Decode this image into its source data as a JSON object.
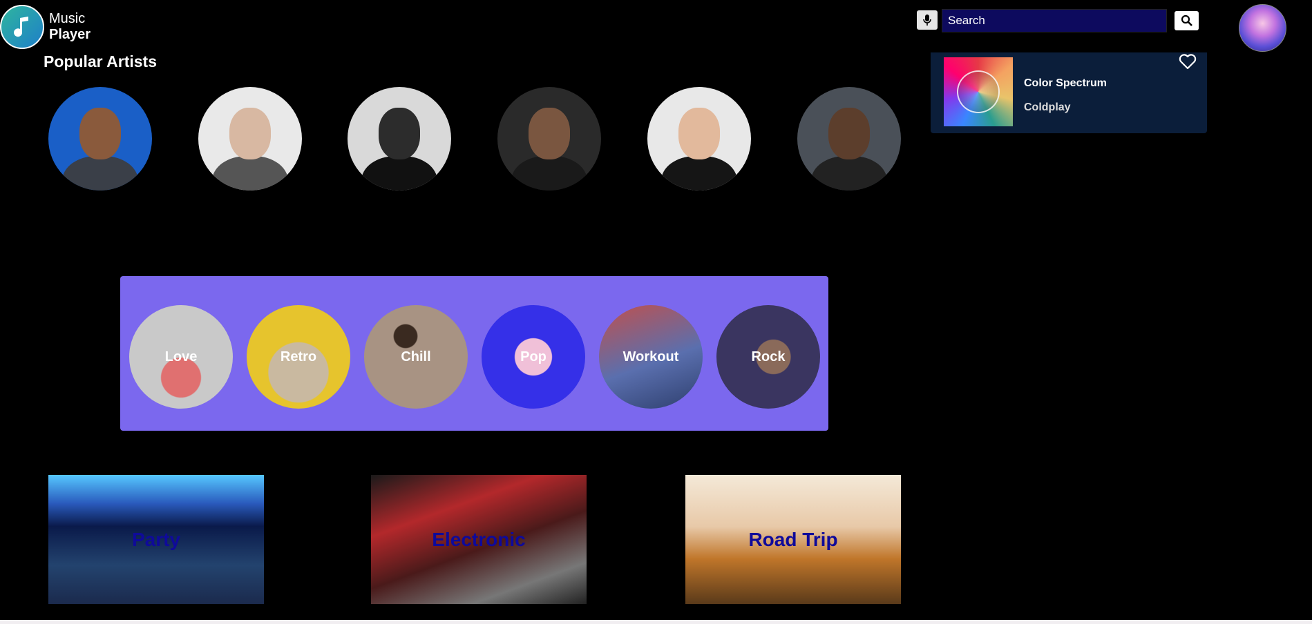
{
  "logo": {
    "line1": "Music",
    "line2": "Player",
    "icon": "music-note-icon"
  },
  "search": {
    "placeholder": "Search",
    "value": "",
    "mic_icon": "microphone-icon",
    "button_icon": "search-icon"
  },
  "profile": {
    "icon": "user-avatar"
  },
  "now_playing": {
    "title": "Color Spectrum",
    "artist": "Coldplay",
    "favorite_icon": "heart-outline-icon"
  },
  "popular_artists": {
    "title": "Popular Artists",
    "count": 6
  },
  "genres": [
    {
      "label": "Love"
    },
    {
      "label": "Retro"
    },
    {
      "label": "Chill"
    },
    {
      "label": "Pop"
    },
    {
      "label": "Workout"
    },
    {
      "label": "Rock"
    }
  ],
  "playlists": [
    {
      "label": "Party"
    },
    {
      "label": "Electronic"
    },
    {
      "label": "Road Trip"
    }
  ],
  "colors": {
    "background": "#000000",
    "search_field": "#0d0a5e",
    "now_playing_card": "#0b1e3a",
    "genre_panel": "#7b68ee",
    "playlist_label": "#0f0a9a"
  }
}
